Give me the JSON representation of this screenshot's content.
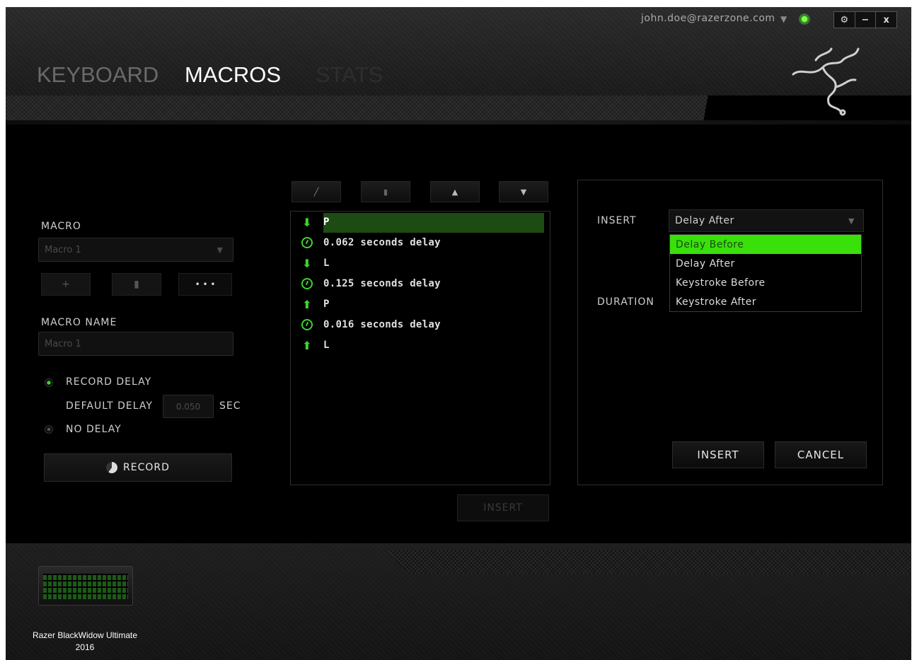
{
  "header": {
    "tabs": [
      {
        "label": "KEYBOARD",
        "active": false
      },
      {
        "label": "MACROS",
        "active": true
      },
      {
        "label": "STATS",
        "active": false
      }
    ],
    "account_email": "john.doe@razerzone.com",
    "window_buttons": [
      "⚙",
      "−",
      "x"
    ]
  },
  "left": {
    "macro_label": "MACRO",
    "macro_select_value": "Macro 1",
    "macro_buttons": [
      "+",
      "▮",
      "• • •"
    ],
    "macro_name_label": "MACRO NAME",
    "macro_name_value": "Macro 1",
    "record_delay_label": "RECORD DELAY",
    "default_delay_label": "DEFAULT DELAY",
    "default_delay_value": "0.050",
    "sec_label": "SEC",
    "no_delay_label": "NO DELAY",
    "record_button": "RECORD"
  },
  "list": {
    "toolbar_icons": [
      "pencil-icon",
      "trash-icon",
      "up-arrow-icon",
      "down-arrow-icon"
    ],
    "items": [
      {
        "kind": "key-down",
        "text": "P",
        "selected": true
      },
      {
        "kind": "delay",
        "text": "0.062 seconds delay",
        "selected": false
      },
      {
        "kind": "key-down",
        "text": "L",
        "selected": false
      },
      {
        "kind": "delay",
        "text": "0.125 seconds delay",
        "selected": false
      },
      {
        "kind": "key-up",
        "text": "P",
        "selected": false
      },
      {
        "kind": "delay",
        "text": "0.016 seconds delay",
        "selected": false
      },
      {
        "kind": "key-up",
        "text": "L",
        "selected": false
      }
    ],
    "insert_button": "INSERT"
  },
  "right": {
    "insert_label": "INSERT",
    "insert_select_value": "Delay After",
    "duration_label": "DURATION",
    "dropdown_options": [
      "Delay Before",
      "Delay After",
      "Keystroke Before",
      "Keystroke After"
    ],
    "dropdown_highlighted": "Delay Before",
    "insert_button": "INSERT",
    "cancel_button": "CANCEL"
  },
  "footer": {
    "device_name_line1": "Razer BlackWidow Ultimate",
    "device_name_line2": "2016"
  },
  "colors": {
    "accent": "#39e00a",
    "selected_row": "#1e4a14",
    "background": "#000000"
  }
}
